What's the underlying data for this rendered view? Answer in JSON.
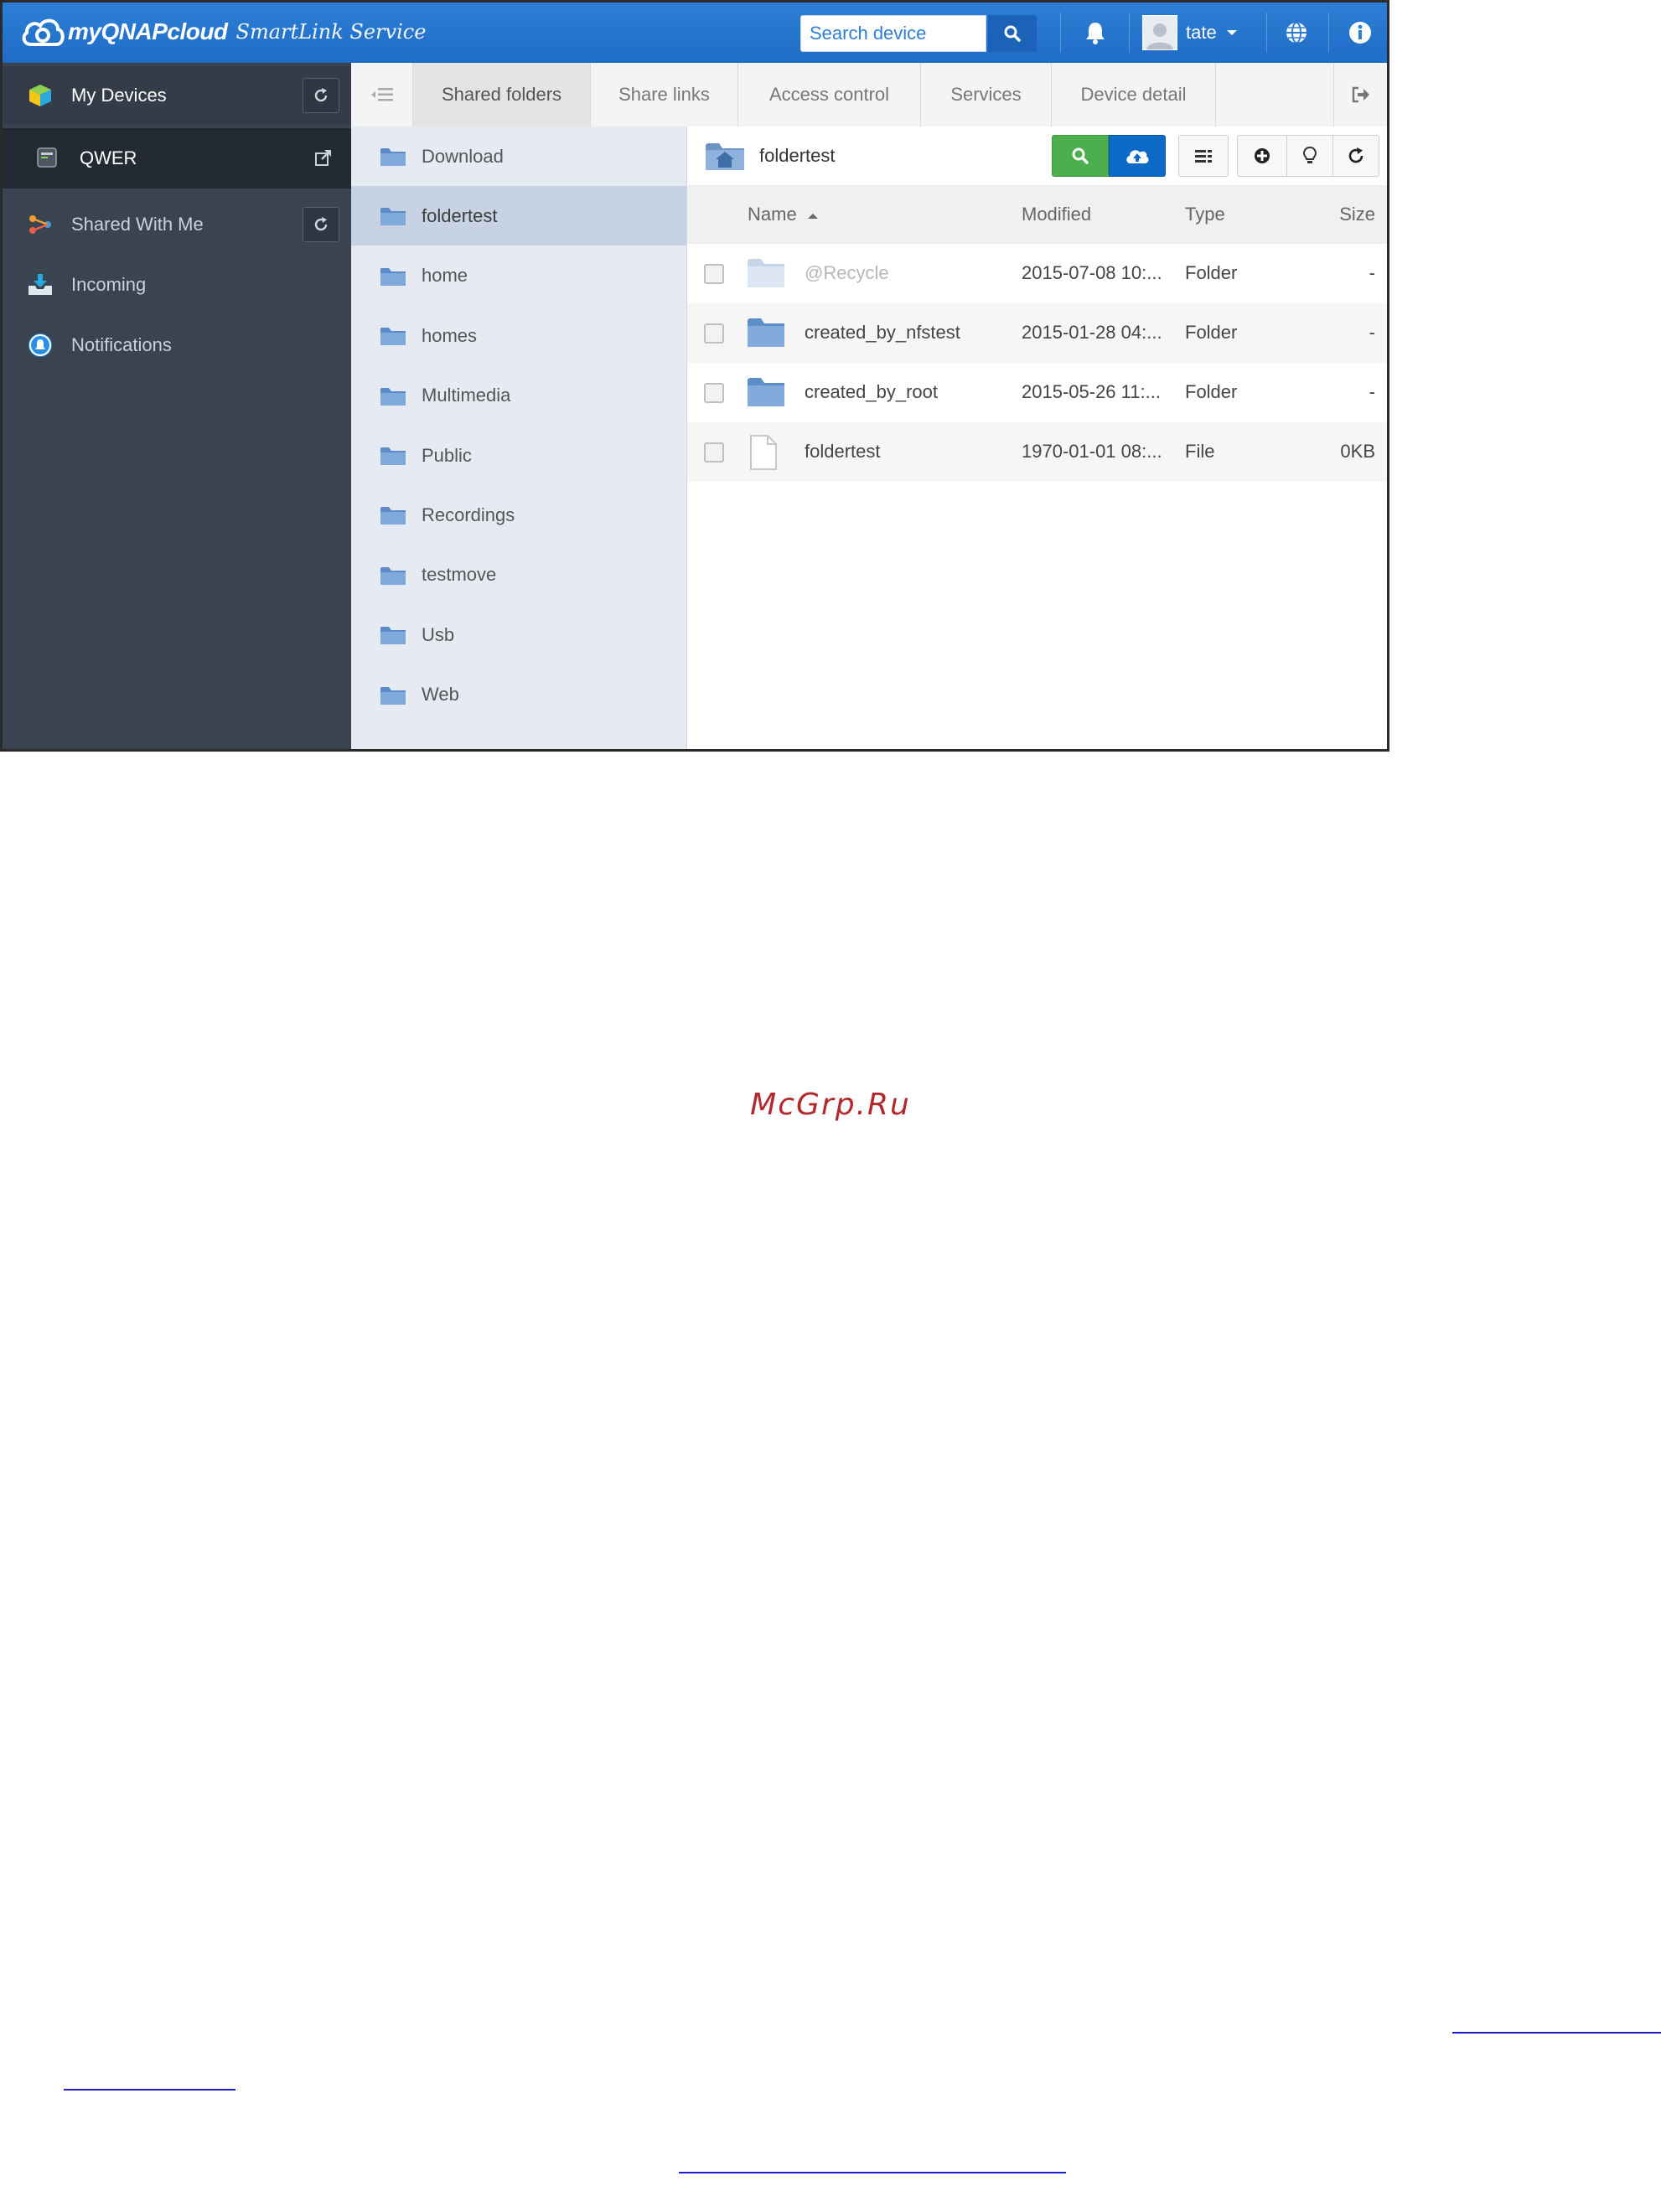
{
  "header": {
    "brand": "myQNAPcloud",
    "tagline": "SmartLink Service",
    "search_placeholder": "Search device",
    "username": "tate"
  },
  "sidebar": {
    "items": [
      {
        "label": "My Devices",
        "icon": "cube-icon"
      },
      {
        "label": "QWER",
        "icon": "nas-icon"
      },
      {
        "label": "Shared With Me",
        "icon": "share-icon"
      },
      {
        "label": "Incoming",
        "icon": "inbox-icon"
      },
      {
        "label": "Notifications",
        "icon": "bell-icon"
      }
    ]
  },
  "tabs": [
    {
      "label": "Shared folders",
      "active": true
    },
    {
      "label": "Share links"
    },
    {
      "label": "Access control"
    },
    {
      "label": "Services"
    },
    {
      "label": "Device detail"
    }
  ],
  "folders": [
    {
      "label": "Download"
    },
    {
      "label": "foldertest",
      "active": true
    },
    {
      "label": "home"
    },
    {
      "label": "homes"
    },
    {
      "label": "Multimedia"
    },
    {
      "label": "Public"
    },
    {
      "label": "Recordings"
    },
    {
      "label": "testmove"
    },
    {
      "label": "Usb"
    },
    {
      "label": "Web"
    }
  ],
  "main": {
    "path": "foldertest",
    "columns": {
      "name": "Name",
      "modified": "Modified",
      "type": "Type",
      "size": "Size"
    },
    "rows": [
      {
        "name": "@Recycle",
        "modified": "2015-07-08 10:...",
        "type": "Folder",
        "size": "-"
      },
      {
        "name": "created_by_nfstest",
        "modified": "2015-01-28 04:...",
        "type": "Folder",
        "size": "-"
      },
      {
        "name": "created_by_root",
        "modified": "2015-05-26 11:...",
        "type": "Folder",
        "size": "-"
      },
      {
        "name": "foldertest",
        "modified": "1970-01-01 08:...",
        "type": "File",
        "size": "0KB"
      }
    ]
  },
  "page": {
    "watermark": "McGrp.Ru"
  },
  "colors": {
    "header_blue": "#2d7fd6",
    "sidebar_bg": "#3a4451",
    "search_green": "#4cae4c",
    "upload_blue": "#0d6bc7",
    "watermark_red": "#b3282d"
  }
}
